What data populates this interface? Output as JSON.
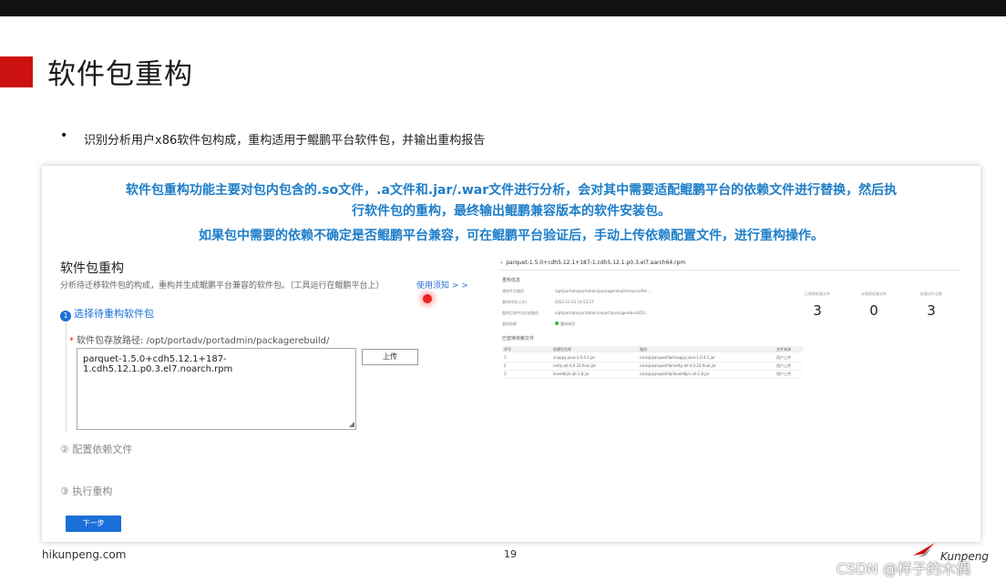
{
  "slide": {
    "title": "软件包重构",
    "bullet_symbol": "•",
    "bullet_text": "识别分析用户x86软件包构成，重构适用于鲲鹏平台软件包，并输出重构报告"
  },
  "banner": {
    "line1": "软件包重构功能主要对包内包含的.so文件，.a文件和.jar/.war文件进行分析，会对其中需要适配鲲鹏平台的依赖文件进行替换，然后执",
    "line2": "行软件包的重构，最终输出鲲鹏兼容版本的软件安装包。",
    "line3": "如果包中需要的依赖不确定是否鲲鹏平台兼容，可在鲲鹏平台验证后，手动上传依赖配置文件，进行重构操作。",
    "color": "#1e7ec8"
  },
  "form": {
    "section_title": "软件包重构",
    "description": "分析待迁移软件包的构成，重构并生成鲲鹏平台兼容的软件包。（工具运行在鲲鹏平台上）",
    "guide_link": "使用须知 > >",
    "step1": {
      "number": "1",
      "label": "选择待重构软件包"
    },
    "path_label_required": "*",
    "path_label": "软件包存放路径: /opt/portadv/portadmin/packagerebuild/",
    "package_value": "parquet-1.5.0+cdh5.12.1+187-1.cdh5.12.1.p0.3.el7.noarch.rpm",
    "upload_label": "上传",
    "step2": "② 配置依赖文件",
    "step3": "③ 执行重构",
    "next_label": "下一步",
    "accent": "#1b6fd8"
  },
  "preview": {
    "back_glyph": "‹",
    "title": "parquet-1.5.0+cdh5.12.1+187-1.cdh5.12.1.p0.3.el7.aarch64.rpm",
    "info_section": "重构信息",
    "info": [
      {
        "key": "源软件包路径",
        "value": "/opt/portadv/portadmin/packagerebuild/source/file ..."
      },
      {
        "key": "重构时间(上次)",
        "value": "2021-11-01 14:53:27"
      },
      {
        "key": "重构后软件包存放路径",
        "value": "/opt/portadv/portadmin/report/packagerebuild/20..."
      },
      {
        "key": "重构结果",
        "value": "重构成功"
      }
    ],
    "stats": [
      {
        "label": "已替换依赖文件",
        "value": "3"
      },
      {
        "label": "未替换依赖文件",
        "value": "0"
      },
      {
        "label": "依赖文件总数",
        "value": "3"
      }
    ],
    "table_section": "已替换依赖文件",
    "table_headers": [
      "序号",
      "依赖包名称",
      "路径",
      "文件来源"
    ],
    "table_rows": [
      [
        "1",
        "snappy-java-1.0.4.1.jar",
        "/unzip/parquet/lib/snappy-java-1.0.4.1.jar",
        "用户上传"
      ],
      [
        "2",
        "netty-all-4.0.23.final.jar",
        "/unzip/parquet/lib/netty-all-4.0.23.final.jar",
        "用户上传"
      ],
      [
        "3",
        "leveldbjni-all-1.8.jar",
        "/unzip/parquet/lib/leveldbjni-all-1.8.jar",
        "用户上传"
      ]
    ]
  },
  "footer": {
    "site": "hikunpeng.com",
    "page": "19",
    "brand": "Kunpeng",
    "watermark": "CSDN @样子的木偶"
  }
}
